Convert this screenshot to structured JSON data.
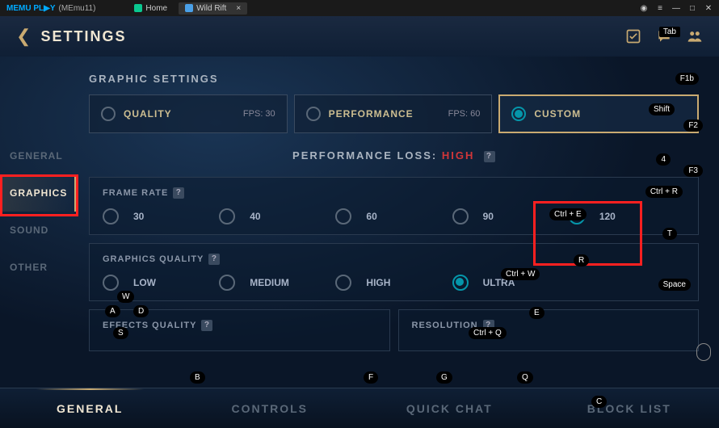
{
  "titlebar": {
    "logo_prefix": "MEMU PL",
    "logo_suffix": "Y",
    "appname": "(MEmu11)",
    "tabs": [
      {
        "label": "Home",
        "iconColor": "#0ac890"
      },
      {
        "label": "Wild Rift",
        "iconColor": "#4aa0e8",
        "close": "×"
      }
    ]
  },
  "header": {
    "title": "SETTINGS",
    "tab_hint": "Tab"
  },
  "sidebar": {
    "items": [
      {
        "label": "GENERAL"
      },
      {
        "label": "GRAPHICS"
      },
      {
        "label": "SOUND"
      },
      {
        "label": "OTHER"
      }
    ]
  },
  "main": {
    "section_title": "GRAPHIC SETTINGS",
    "presets": [
      {
        "label": "QUALITY",
        "fps": "FPS:  30"
      },
      {
        "label": "PERFORMANCE",
        "fps": "FPS:  60"
      },
      {
        "label": "CUSTOM",
        "fps": ""
      }
    ],
    "perf_loss_label": "PERFORMANCE LOSS: ",
    "perf_loss_value": "HIGH",
    "frame_rate": {
      "label": "FRAME RATE",
      "options": [
        "30",
        "40",
        "60",
        "90",
        "120"
      ]
    },
    "graphics_quality": {
      "label": "GRAPHICS QUALITY",
      "options": [
        "LOW",
        "MEDIUM",
        "HIGH",
        "ULTRA"
      ]
    },
    "effects_quality": {
      "label": "EFFECTS QUALITY"
    },
    "resolution": {
      "label": "RESOLUTION"
    }
  },
  "bottom_tabs": [
    "GENERAL",
    "CONTROLS",
    "QUICK CHAT",
    "BLOCK LIST"
  ],
  "keyhints": {
    "f1b": "F1b",
    "shift": "Shift",
    "f2": "F2",
    "four": "4",
    "f3": "F3",
    "ctrlr": "Ctrl + R",
    "ctrle": "Ctrl + E",
    "t": "T",
    "r": "R",
    "ctrlw": "Ctrl + W",
    "space": "Space",
    "w": "W",
    "a": "A",
    "d": "D",
    "s": "S",
    "e": "E",
    "ctrlq": "Ctrl + Q",
    "b": "B",
    "f": "F",
    "g": "G",
    "q": "Q",
    "c": "C"
  }
}
